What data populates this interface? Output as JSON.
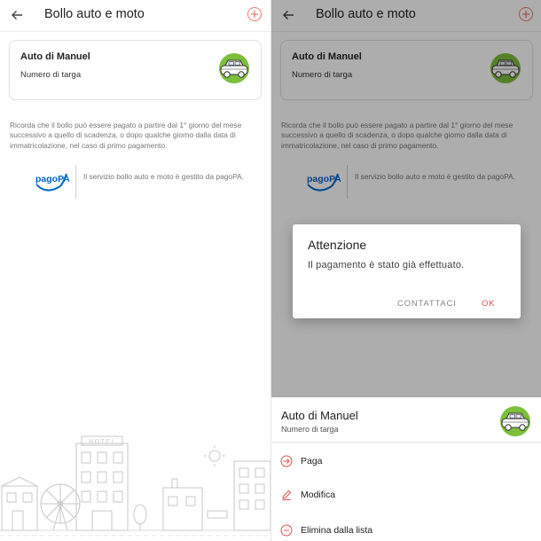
{
  "app_bar": {
    "title": "Bollo auto e moto"
  },
  "vehicle": {
    "name": "Auto di Manuel",
    "plate_label": "Numero di targa"
  },
  "notice": "Ricorda che il bollo può essere pagato a partire dal 1° giorno del mese successivo a quello di scadenza, o dopo qualche giorno dalla data di immatricolazione, nel caso di primo pagamento.",
  "pagopa": {
    "logo_text": "pagoPA",
    "info": "Il servizio bollo auto e moto è gestito da pagoPA."
  },
  "illustration": {
    "sign_text": "HOTEL"
  },
  "dialog": {
    "title": "Attenzione",
    "message": "Il pagamento è stato già effettuato.",
    "contact_label": "CONTATTACI",
    "ok_label": "OK"
  },
  "sheet": {
    "name": "Auto di Manuel",
    "plate_label": "Numero di targa",
    "options": [
      {
        "label": "Paga",
        "icon": "arrow-circle-icon"
      },
      {
        "label": "Modifica",
        "icon": "pencil-icon"
      },
      {
        "label": "Elimina dalla lista",
        "icon": "minus-circle-icon"
      }
    ]
  },
  "colors": {
    "accent": "#e0524b",
    "car_green": "#7cbf3a",
    "pagopa_blue": "#0066cc",
    "scrim": "rgba(0,0,0,0.32)"
  }
}
